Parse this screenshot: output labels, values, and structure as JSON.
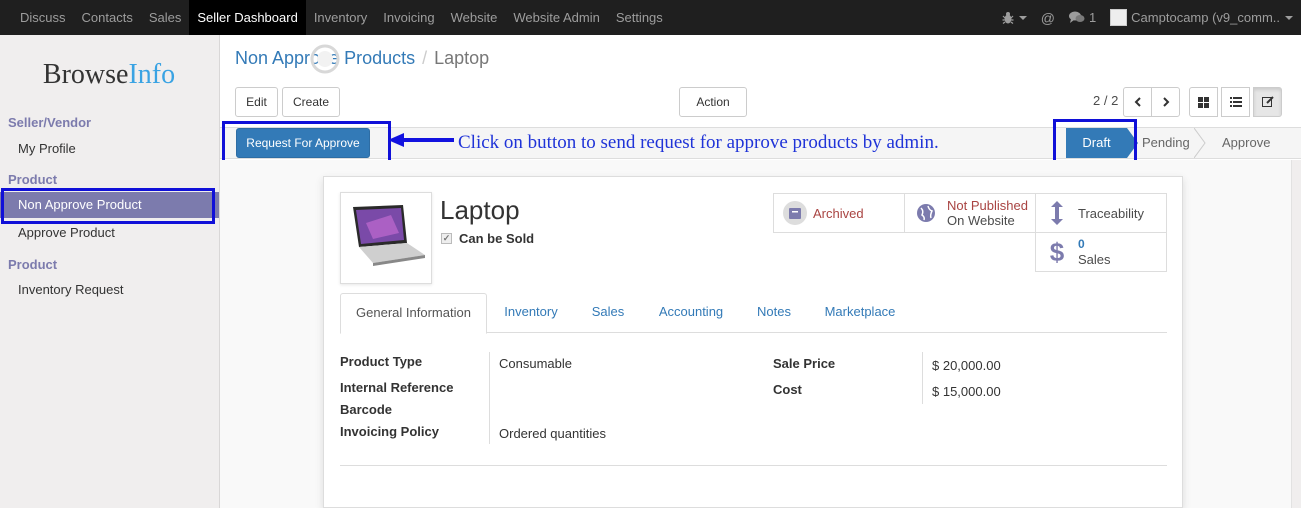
{
  "topbar": {
    "menu": [
      "Discuss",
      "Contacts",
      "Sales",
      "Seller Dashboard",
      "Inventory",
      "Invoicing",
      "Website",
      "Website Admin",
      "Settings"
    ],
    "active_index": 3,
    "messages_count": "1",
    "user": "Camptocamp (v9_comm.."
  },
  "sidebar": {
    "logo_part1": "Browse",
    "logo_part2": "Info",
    "section1": "Seller/Vendor",
    "my_profile": "My Profile",
    "section2": "Product",
    "non_approve": "Non Approve Product",
    "approve": "Approve Product",
    "section3": "Product",
    "inventory_request": "Inventory Request"
  },
  "breadcrumb": {
    "parent": "Non Approve Products",
    "separator": "/",
    "current": "Laptop"
  },
  "buttons": {
    "edit": "Edit",
    "create": "Create",
    "action": "Action"
  },
  "pager": {
    "text": "2 / 2"
  },
  "statusbar": {
    "request_button": "Request For Approve",
    "annotation": "Click on button to send request for approve products by admin.",
    "stages": [
      "Draft",
      "Pending",
      "Approve"
    ],
    "current_stage": "Draft"
  },
  "product": {
    "name": "Laptop",
    "can_be_sold": "Can be Sold",
    "archived": "Archived",
    "not_published": "Not Published",
    "on_website": "On Website",
    "traceability": "Traceability",
    "sales_count": "0",
    "sales_label": "Sales"
  },
  "tabs": [
    "General Information",
    "Inventory",
    "Sales",
    "Accounting",
    "Notes",
    "Marketplace"
  ],
  "fields": {
    "product_type_label": "Product Type",
    "product_type": "Consumable",
    "internal_ref_label": "Internal Reference",
    "barcode_label": "Barcode",
    "invoicing_policy_label": "Invoicing Policy",
    "invoicing_policy": "Ordered quantities",
    "sale_price_label": "Sale Price",
    "sale_price": "$ 20,000.00",
    "cost_label": "Cost",
    "cost": "$ 15,000.00"
  },
  "colors": {
    "primary": "#337ab7",
    "sidebar_accent": "#7c7bad",
    "annotation": "#1010d8",
    "archived": "#a94442"
  }
}
